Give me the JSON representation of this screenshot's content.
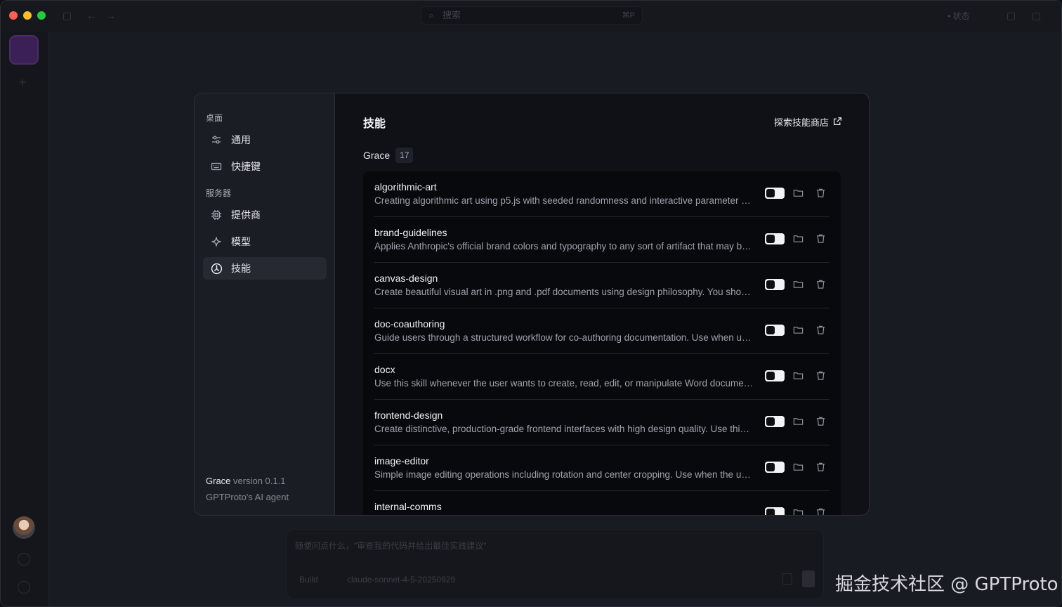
{
  "titlebar": {
    "search_placeholder": "搜索",
    "search_shortcut": "⌘P",
    "right_label": "状态"
  },
  "composer": {
    "placeholder": "随便问点什么，\"审查我的代码并给出最佳实践建议\"",
    "mode": "Build",
    "model": "claude-sonnet-4-5-20250929"
  },
  "settings": {
    "sidebar": {
      "section_desktop": "桌面",
      "item_general": "通用",
      "item_shortcuts": "快捷键",
      "section_server": "服务器",
      "item_providers": "提供商",
      "item_models": "模型",
      "item_skills": "技能",
      "app_name": "Grace",
      "version": "version 0.1.1",
      "tagline": "GPTProto's AI agent"
    },
    "main": {
      "title": "技能",
      "store_link": "探索技能商店",
      "group_name": "Grace",
      "group_count": "17",
      "skills": [
        {
          "name": "algorithmic-art",
          "desc": "Creating algorithmic art using p5.js with seeded randomness and interactive parameter exploration."
        },
        {
          "name": "brand-guidelines",
          "desc": "Applies Anthropic's official brand colors and typography to any sort of artifact that may benefit from it."
        },
        {
          "name": "canvas-design",
          "desc": "Create beautiful visual art in .png and .pdf documents using design philosophy. You should use this skill."
        },
        {
          "name": "doc-coauthoring",
          "desc": "Guide users through a structured workflow for co-authoring documentation. Use when user wants to write."
        },
        {
          "name": "docx",
          "desc": "Use this skill whenever the user wants to create, read, edit, or manipulate Word documents."
        },
        {
          "name": "frontend-design",
          "desc": "Create distinctive, production-grade frontend interfaces with high design quality. Use this skill."
        },
        {
          "name": "image-editor",
          "desc": "Simple image editing operations including rotation and center cropping. Use when the user asks."
        },
        {
          "name": "internal-comms",
          "desc": ""
        }
      ]
    }
  },
  "watermark": "掘金技术社区 @ GPTProto"
}
